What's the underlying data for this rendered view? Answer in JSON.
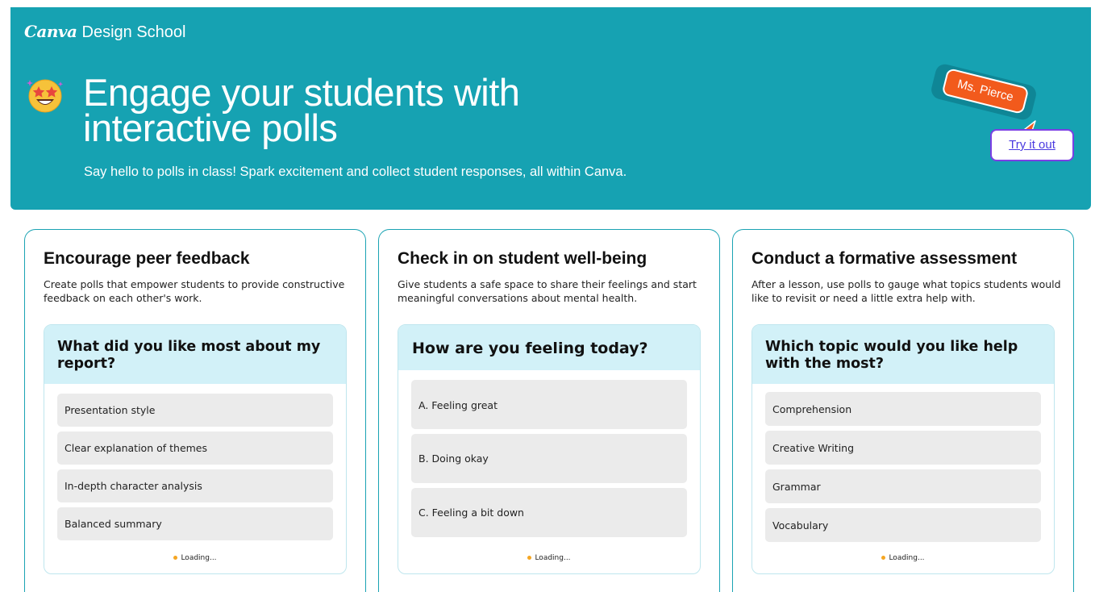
{
  "header": {
    "brand_logo": "Canva",
    "brand_text": "Design School",
    "emoji_icon": "star-struck-emoji",
    "title": "Engage your students with interactive polls",
    "subtitle": "Say hello to polls in class! Spark excitement and collect student responses, all within Canva.",
    "name_tag": "Ms. Pierce",
    "try_button": "Try it out"
  },
  "cards": [
    {
      "title": "Encourage peer feedback",
      "description": "Create polls that empower students to provide constructive feedback on each other's work.",
      "poll": {
        "question": "What did you like most about my report?",
        "options": [
          "Presentation style",
          "Clear explanation of themes",
          "In-depth character analysis",
          "Balanced summary"
        ],
        "status": "Loading..."
      }
    },
    {
      "title": "Check in on student well-being",
      "description": "Give students a safe space to share their feelings and start meaningful conversations about mental health.",
      "poll": {
        "question": "How are you feeling today?",
        "options": [
          "A. Feeling great",
          "B. Doing okay",
          "C. Feeling a bit down"
        ],
        "status": "Loading..."
      }
    },
    {
      "title": "Conduct a formative assessment",
      "description": "After a lesson, use polls to gauge what topics students would like to revisit or need a little extra help with.",
      "poll": {
        "question": "Which topic would you like help with the most?",
        "options": [
          "Comprehension",
          "Creative Writing",
          "Grammar",
          "Vocabulary"
        ],
        "status": "Loading..."
      }
    }
  ],
  "colors": {
    "hero_bg": "#16a2b2",
    "accent_orange": "#f25a1c",
    "button_border": "#7b3fe4",
    "poll_header_bg": "#d2f1f8",
    "option_bg": "#ebebeb"
  }
}
